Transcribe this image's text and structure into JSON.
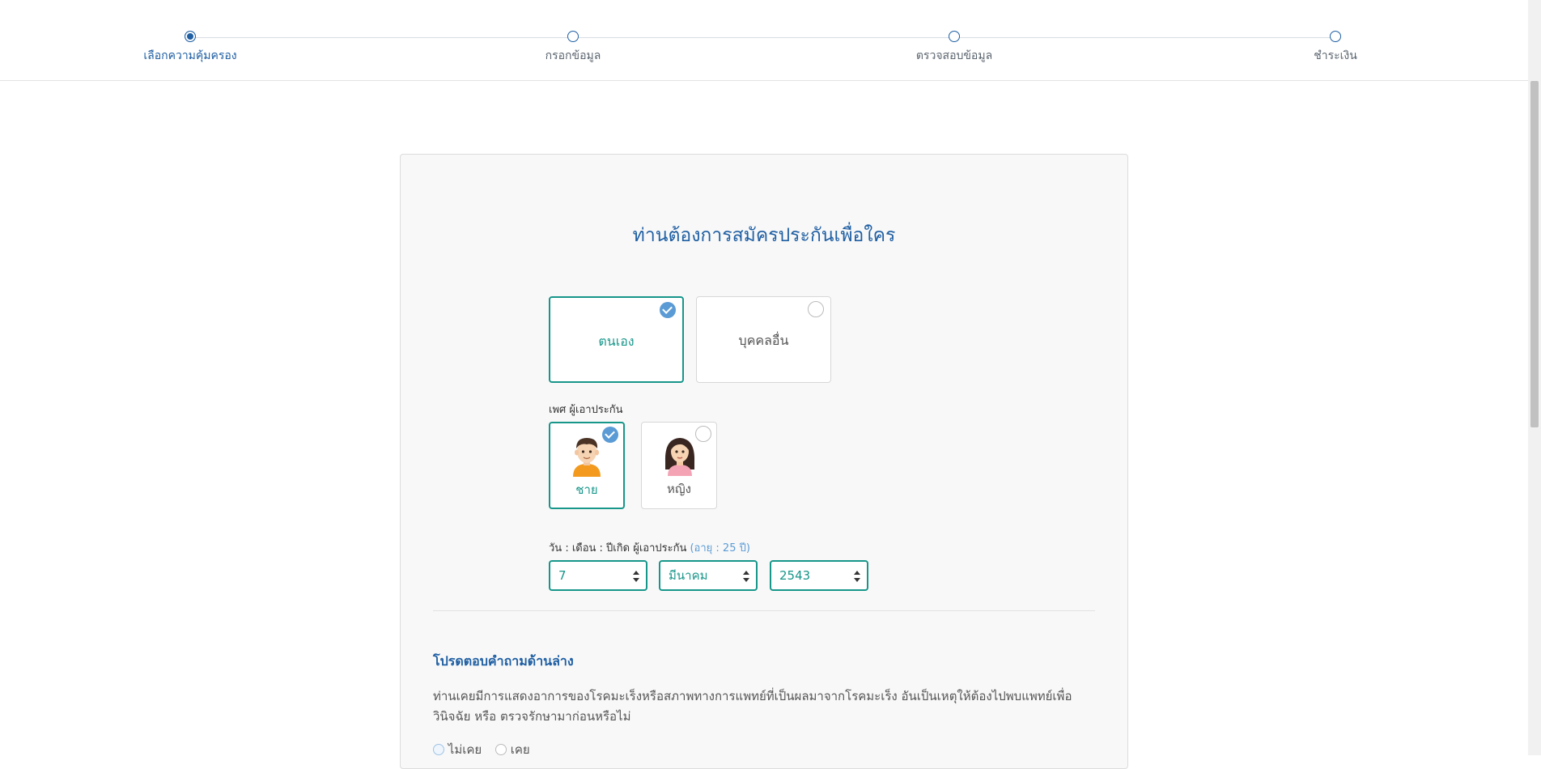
{
  "stepper": {
    "steps": [
      {
        "label": "เลือกความคุ้มครอง",
        "active": true
      },
      {
        "label": "กรอกข้อมูล",
        "active": false
      },
      {
        "label": "ตรวจสอบข้อมูล",
        "active": false
      },
      {
        "label": "ชำระเงิน",
        "active": false
      }
    ]
  },
  "form": {
    "title": "ท่านต้องการสมัครประกันเพื่อใคร",
    "applicant": {
      "options": [
        "ตนเอง",
        "บุคคลอื่น"
      ],
      "selected": "ตนเอง"
    },
    "gender": {
      "label": "เพศ ผู้เอาประกัน",
      "options": [
        "ชาย",
        "หญิง"
      ],
      "selected": "ชาย"
    },
    "dob": {
      "label": "วัน : เดือน : ปีเกิด ผู้เอาประกัน",
      "age_note": "(อายุ : 25 ปี)",
      "day": "7",
      "month": "มีนาคม",
      "year": "2543"
    },
    "question_section": {
      "title": "โปรดตอบคำถามด้านล่าง",
      "question": "ท่านเคยมีการแสดงอาการของโรคมะเร็งหรือสภาพทางการแพทย์ที่เป็นผลมาจากโรคมะเร็ง อันเป็นเหตุให้ต้องไปพบแพทย์เพื่อวินิจฉัย หรือ ตรวจรักษามาก่อนหรือไม่",
      "answers": [
        "ไม่เคย",
        "เคย"
      ]
    }
  },
  "colors": {
    "primary_blue": "#1f5fa3",
    "accent_teal": "#17968a",
    "check_blue": "#5b9bd5"
  }
}
